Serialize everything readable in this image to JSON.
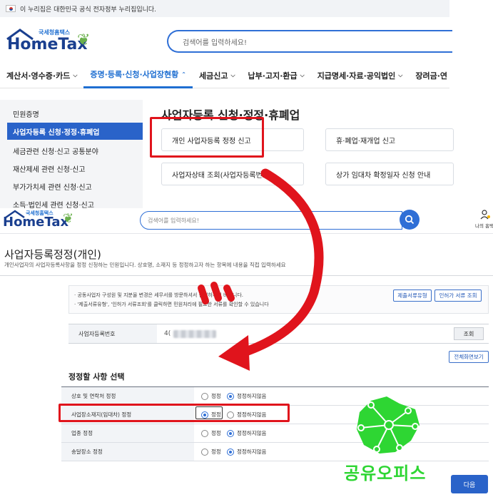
{
  "gov_banner": {
    "text": "이 누리집은 대한민국 공식 전자정부 누리집입니다."
  },
  "logo": {
    "subtitle": "국세청홈택스",
    "name": "HomeTax"
  },
  "search_top": {
    "placeholder": "검색어를 입력하세요!"
  },
  "nav": [
    {
      "label": "계산서·영수증·카드",
      "active": false
    },
    {
      "label": "증명·등록·신청·사업장현황",
      "active": true
    },
    {
      "label": "세금신고",
      "active": false
    },
    {
      "label": "납부·고지·환급",
      "active": false
    },
    {
      "label": "지급명세·자료·공익법인",
      "active": false
    },
    {
      "label": "장려금·연",
      "active": false
    }
  ],
  "left_menu": {
    "items": [
      "민원증명",
      "사업자등록 신청·정정·휴폐업",
      "세금관련 신청·신고 공통분야",
      "재산제세 관련 신청·신고",
      "부가가치세 관련 신청·신고",
      "소득·법인세 관련 신청·신고"
    ],
    "active_index": 1
  },
  "section": {
    "title": "사업자등록 신청·정정·휴폐업",
    "cards": [
      "개인 사업자등록 정정 신고",
      "휴·폐업·재개업 신고",
      "사업자상태 조회(사업자등록번호)",
      "상가 임대차 확정일자 신청 안내"
    ]
  },
  "second": {
    "search_placeholder": "검색어를 입력하세요!",
    "user_label": "나의 홈택",
    "page_title": "사업자등록정정(개인)",
    "page_desc": "개인사업자의 사업자등록사항을 정정 신청하는 민원입니다. 상호명, 소재지 등 정정하고자 하는 항목에 내용을 직접 입력하세요",
    "notes": [
      "· 공동사업자 구성원 및 지분율 변경은 세무서를 방문하셔서 신청하시기 바랍니다.",
      "· '제출서류유형', '인허가 서류조회'를 클릭하면 민원처리에 필요한 서류를 확인할 수 있습니다"
    ],
    "btn_doc_type": "제출서류유형",
    "btn_permit": "인허가 서류 조회",
    "bizno_label": "사업자등록번호",
    "bizno_prefix": "4(",
    "btn_lookup": "조회",
    "btn_fullscreen": "전체화면보기",
    "select_title": "정정할 사항 선택",
    "options": [
      {
        "label": "상호 및 연락처 정정",
        "selected": "정정하지않음"
      },
      {
        "label": "사업장소재지(임대차) 정정",
        "selected": "정정"
      },
      {
        "label": "업종 정정",
        "selected": "정정하지않음"
      },
      {
        "label": "송달장소 정정",
        "selected": "정정하지않음"
      }
    ],
    "radio_yes": "정정",
    "radio_no": "정정하지않음",
    "next_button": "다음"
  },
  "watermark": {
    "text": "공유오피스"
  },
  "colors": {
    "accent": "#2a63c9",
    "highlight": "#e0141c",
    "brand_green": "#2ed633"
  }
}
